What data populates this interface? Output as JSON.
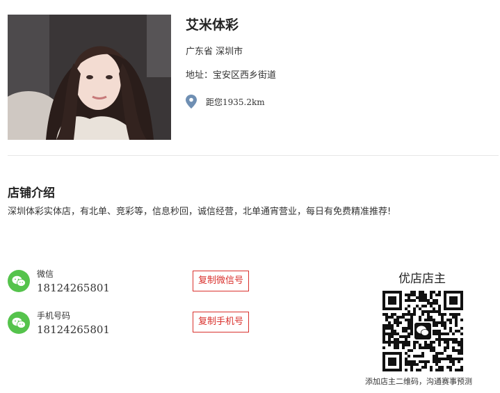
{
  "shop": {
    "name": "艾米体彩",
    "region": "广东省 深圳市",
    "address": "地址：宝安区西乡街道",
    "distance": "距您1935.2km"
  },
  "intro": {
    "title": "店铺介绍",
    "text": "深圳体彩实体店，有北单、竞彩等，信息秒回，诚信经营，北单通宵营业，每日有免费精准推荐!"
  },
  "contacts": {
    "wechat": {
      "label": "微信",
      "value": "18124265801",
      "copy_label": "复制微信号",
      "icon": "wechat-icon"
    },
    "phone": {
      "label": "手机号码",
      "value": "18124265801",
      "copy_label": "复制手机号",
      "icon": "wechat-icon"
    }
  },
  "owner": {
    "title": "优店店主",
    "qr_caption": "添加店主二维码，沟通赛事预测"
  },
  "colors": {
    "accent_red": "#d9302c",
    "wechat_green": "#55c34c",
    "pin_blue": "#6f8fb3"
  }
}
